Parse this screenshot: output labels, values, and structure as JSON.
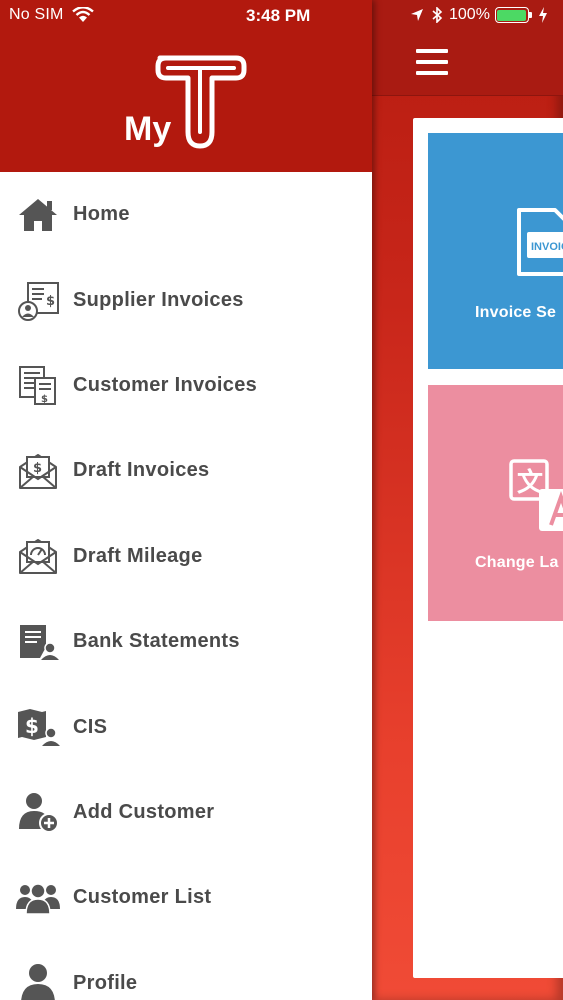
{
  "status_bar": {
    "carrier": "No SIM",
    "time": "3:48 PM",
    "battery": "100%",
    "battery_level": 1.0,
    "battery_color": "#4cd964"
  },
  "drawer": {
    "logo_text": "My",
    "logo_letter": "T",
    "header_color": "#b2190e",
    "items": [
      {
        "label": "Home",
        "icon": "home-icon"
      },
      {
        "label": "Supplier Invoices",
        "icon": "supplier-invoice-icon"
      },
      {
        "label": "Customer Invoices",
        "icon": "customer-invoice-icon"
      },
      {
        "label": "Draft Invoices",
        "icon": "draft-invoice-icon"
      },
      {
        "label": "Draft Mileage",
        "icon": "draft-mileage-icon"
      },
      {
        "label": "Bank Statements",
        "icon": "bank-statement-icon"
      },
      {
        "label": "CIS",
        "icon": "cis-icon"
      },
      {
        "label": "Add Customer",
        "icon": "add-customer-icon"
      },
      {
        "label": "Customer List",
        "icon": "customer-list-icon"
      },
      {
        "label": "Profile",
        "icon": "profile-icon"
      }
    ]
  },
  "main": {
    "menu_icon": "hamburger-icon",
    "tiles": [
      {
        "label": "Invoice Se",
        "icon_text": "INVOIC",
        "color": "#3c97d2",
        "icon": "invoice-icon"
      },
      {
        "label": "Change La",
        "icon_text": "文",
        "color": "#ec8ea0",
        "icon": "translate-icon"
      }
    ]
  }
}
